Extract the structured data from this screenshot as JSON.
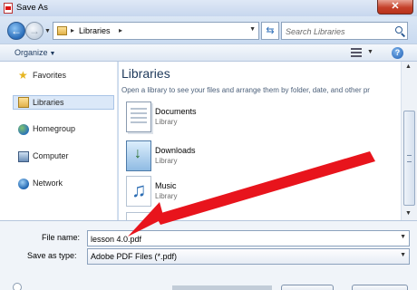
{
  "window": {
    "title": "Save As",
    "close_glyph": "✕"
  },
  "nav": {
    "back_glyph": "←",
    "forward_glyph": "→",
    "breadcrumb": "Libraries",
    "search_placeholder": "Search Libraries",
    "refresh_glyph": "⇆"
  },
  "toolbar": {
    "organize_label": "Organize",
    "help_glyph": "?"
  },
  "sidebar": {
    "items": [
      {
        "label": "Favorites",
        "icon": "star-icon"
      },
      {
        "label": "Libraries",
        "icon": "libraries-icon",
        "selected": true
      },
      {
        "label": "Homegroup",
        "icon": "homegroup-icon"
      },
      {
        "label": "Computer",
        "icon": "computer-icon"
      },
      {
        "label": "Network",
        "icon": "network-icon"
      }
    ]
  },
  "main": {
    "heading": "Libraries",
    "subtitle": "Open a library to see your files and arrange them by folder, date, and other pr",
    "libraries": [
      {
        "name": "Documents",
        "kind": "Library",
        "icon": "documents-library-icon"
      },
      {
        "name": "Downloads",
        "kind": "Library",
        "icon": "downloads-library-icon"
      },
      {
        "name": "Music",
        "kind": "Library",
        "icon": "music-library-icon"
      }
    ]
  },
  "form": {
    "file_name_label": "File name:",
    "file_name_value": "lesson 4.0.pdf",
    "save_as_type_label": "Save as type:",
    "save_as_type_value": "Adobe PDF Files (*.pdf)"
  },
  "overlay": {
    "arrow_color": "#e8141c"
  }
}
